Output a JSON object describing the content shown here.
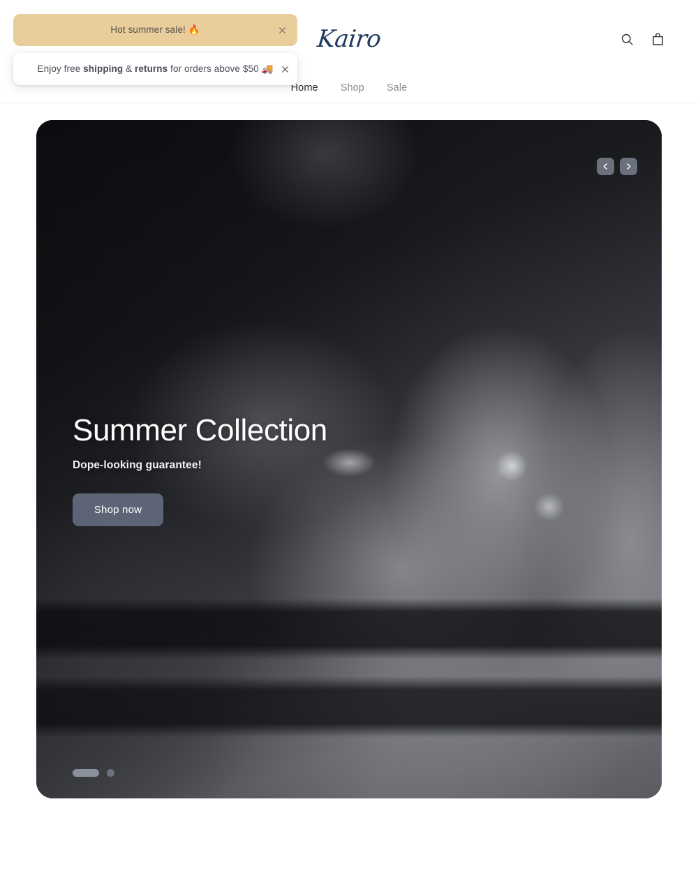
{
  "brand": {
    "name": "Kairo",
    "logo_color": "#1e3a5f"
  },
  "toasts": [
    {
      "id": "hot-summer-sale",
      "text": "Hot summer sale! 🔥",
      "background": "#e9cd9b",
      "close_label": "✕"
    },
    {
      "id": "free-shipping",
      "text_plain": "Enjoy free shipping & returns for orders above $50 🚚",
      "prefix": "Enjoy free ",
      "bold_1": "shipping",
      "middle": " & ",
      "bold_2": "returns",
      "suffix": " for orders above $50 🚚",
      "background": "#ffffff",
      "close_label": "✕"
    }
  ],
  "header": {
    "search_icon": "search-icon",
    "cart_icon": "shopping-bag-icon"
  },
  "nav": {
    "items": [
      {
        "label": "Home",
        "active": true
      },
      {
        "label": "Shop",
        "active": false
      },
      {
        "label": "Sale",
        "active": false
      }
    ]
  },
  "hero": {
    "title": "Summer Collection",
    "subtitle": "Dope-looking guarantee!",
    "cta_label": "Shop now",
    "cta_color": "#5d6475",
    "prev_icon": "chevron-left-icon",
    "next_icon": "chevron-right-icon",
    "slides_total": 2,
    "slide_current": 1,
    "image_description": "Black and white close-up of a man's hand with signet rings and leather bracelets"
  }
}
